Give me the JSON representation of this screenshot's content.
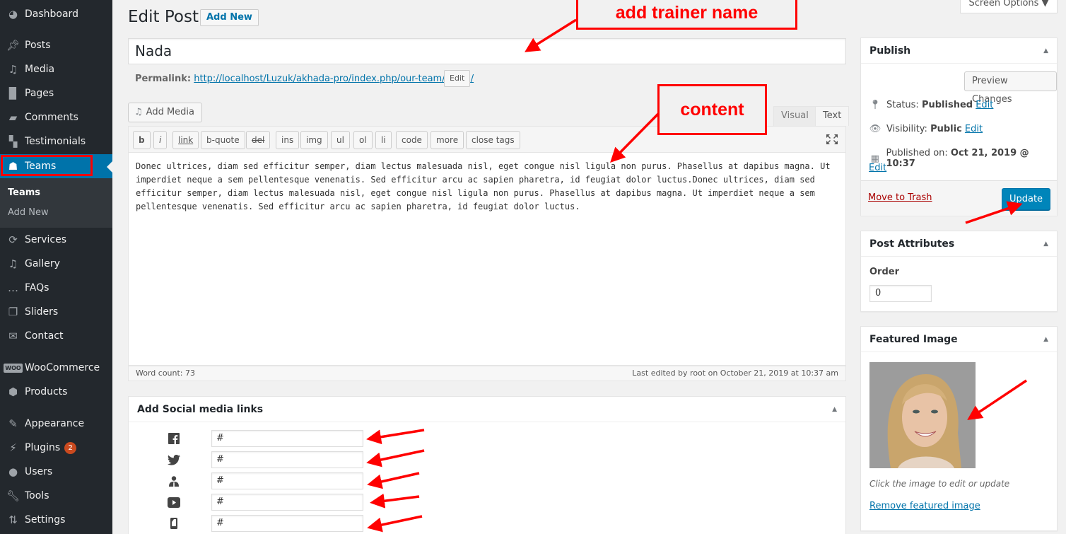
{
  "sidebar": {
    "items": [
      {
        "label": "Dashboard",
        "icon": "dashboard-icon"
      },
      {
        "label": "Posts",
        "icon": "pin-icon"
      },
      {
        "label": "Media",
        "icon": "media-icon"
      },
      {
        "label": "Pages",
        "icon": "pages-icon"
      },
      {
        "label": "Comments",
        "icon": "comment-icon"
      },
      {
        "label": "Testimonials",
        "icon": "testimonials-icon"
      },
      {
        "label": "Teams",
        "icon": "groups-icon",
        "active": true
      },
      {
        "label": "Services",
        "icon": "sync-icon"
      },
      {
        "label": "Gallery",
        "icon": "media-icon"
      },
      {
        "label": "FAQs",
        "icon": "chat-bubble-icon"
      },
      {
        "label": "Sliders",
        "icon": "images-icon"
      },
      {
        "label": "Contact",
        "icon": "envelope-icon"
      },
      {
        "label": "WooCommerce",
        "icon": "woo-icon"
      },
      {
        "label": "Products",
        "icon": "box-icon"
      },
      {
        "label": "Appearance",
        "icon": "brush-icon"
      },
      {
        "label": "Plugins",
        "icon": "plug-icon",
        "badge": "2"
      },
      {
        "label": "Users",
        "icon": "user-icon"
      },
      {
        "label": "Tools",
        "icon": "wrench-icon"
      },
      {
        "label": "Settings",
        "icon": "settings-icon"
      }
    ],
    "submenu": [
      {
        "label": "Teams",
        "current": true
      },
      {
        "label": "Add New"
      }
    ]
  },
  "header": {
    "title": "Edit Post",
    "add_new": "Add New",
    "screen_options": "Screen Options ▼"
  },
  "post": {
    "title": "Nada",
    "permalink_label": "Permalink:",
    "permalink_base": "http://localhost/Luzuk/akhada-pro/index.php/our-team/",
    "permalink_slug": "nada",
    "permalink_trail": "/",
    "permalink_edit": "Edit"
  },
  "editor": {
    "add_media": "Add Media",
    "tab_visual": "Visual",
    "tab_text": "Text",
    "quicktags": [
      "b",
      "i",
      "link",
      "b-quote",
      "del",
      "ins",
      "img",
      "ul",
      "ol",
      "li",
      "code",
      "more",
      "close tags"
    ],
    "content": "Donec ultrices, diam sed efficitur semper, diam lectus malesuada nisl, eget congue nisl ligula non purus. Phasellus at dapibus magna. Ut imperdiet neque a sem pellentesque venenatis. Sed efficitur arcu ac sapien pharetra, id feugiat dolor luctus.Donec ultrices, diam sed efficitur semper, diam lectus malesuada nisl, eget congue nisl ligula non purus. Phasellus at dapibus magna. Ut imperdiet neque a sem pellentesque venenatis. Sed efficitur arcu ac sapien pharetra, id feugiat dolor luctus.",
    "word_count": "Word count: 73",
    "last_edited": "Last edited by root on October 21, 2019 at 10:37 am"
  },
  "social": {
    "title": "Add Social media links",
    "links": [
      {
        "icon": "facebook-icon",
        "value": "#"
      },
      {
        "icon": "twitter-icon",
        "value": "#"
      },
      {
        "icon": "person-icon",
        "value": "#"
      },
      {
        "icon": "youtube-icon",
        "value": "#"
      },
      {
        "icon": "mobile-icon",
        "value": "#"
      }
    ]
  },
  "publish": {
    "title": "Publish",
    "preview": "Preview Changes",
    "status_label": "Status:",
    "status_value": "Published",
    "visibility_label": "Visibility:",
    "visibility_value": "Public",
    "published_label": "Published on:",
    "published_value": "Oct 21, 2019 @ 10:37",
    "edit": "Edit",
    "trash": "Move to Trash",
    "update": "Update"
  },
  "attributes": {
    "title": "Post Attributes",
    "order_label": "Order",
    "order_value": "0"
  },
  "featured": {
    "title": "Featured Image",
    "caption": "Click the image to edit or update",
    "remove": "Remove featured image"
  },
  "annotations": {
    "trainer": "add trainer name",
    "content": "content",
    "color": "#ff0000"
  }
}
